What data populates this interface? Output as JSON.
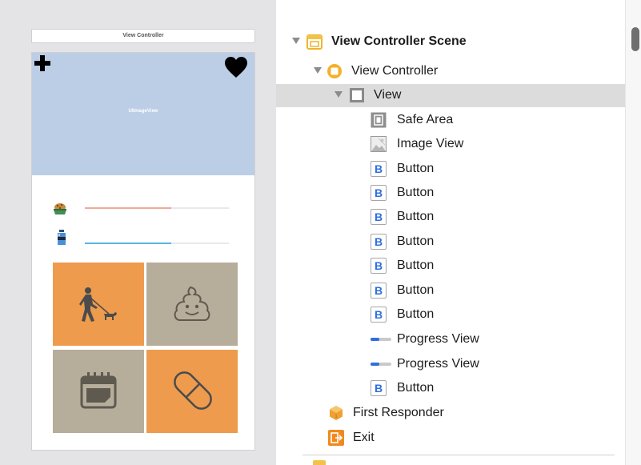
{
  "canvas": {
    "scene_title": "View Controller",
    "image_view_label": "UIImageView",
    "progress_bars": [
      {
        "name": "hunger",
        "fill_fraction": 0.61,
        "color": "#f2a898"
      },
      {
        "name": "thirst",
        "fill_fraction": 0.61,
        "color": "#58b6e4"
      }
    ],
    "tiles": [
      {
        "icon": "walk-dog-icon",
        "color": "#ee9b4d"
      },
      {
        "icon": "poop-icon",
        "color": "#b6ad9b"
      },
      {
        "icon": "calendar-icon",
        "color": "#b6ad9b"
      },
      {
        "icon": "pill-icon",
        "color": "#ee9b4d"
      }
    ]
  },
  "outline": {
    "scene": "View Controller Scene",
    "view_controller": "View Controller",
    "view": "View",
    "children": [
      {
        "label": "Safe Area",
        "icon": "safe-area-icon"
      },
      {
        "label": "Image View",
        "icon": "image-view-icon"
      },
      {
        "label": "Button",
        "icon": "button-icon"
      },
      {
        "label": "Button",
        "icon": "button-icon"
      },
      {
        "label": "Button",
        "icon": "button-icon"
      },
      {
        "label": "Button",
        "icon": "button-icon"
      },
      {
        "label": "Button",
        "icon": "button-icon"
      },
      {
        "label": "Button",
        "icon": "button-icon"
      },
      {
        "label": "Button",
        "icon": "button-icon"
      },
      {
        "label": "Progress View",
        "icon": "progress-view-icon"
      },
      {
        "label": "Progress View",
        "icon": "progress-view-icon"
      },
      {
        "label": "Button",
        "icon": "button-icon"
      }
    ],
    "first_responder": "First Responder",
    "exit": "Exit",
    "button_glyph": "B"
  },
  "colors": {
    "image_view_bg": "#bccde6",
    "selection": "#dcdcdc",
    "accent_blue": "#2f6fde",
    "scene_yellow": "#f3c24a",
    "responder_orange": "#f0a030"
  }
}
